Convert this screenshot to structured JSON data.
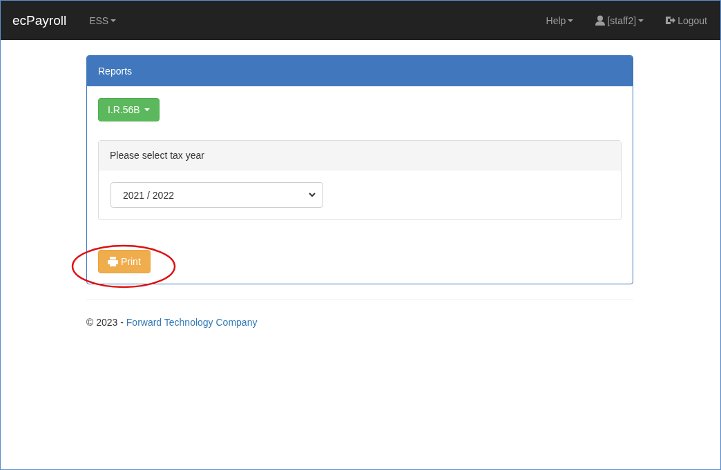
{
  "navbar": {
    "brand": "ecPayroll",
    "left_menu": [
      {
        "label": "ESS"
      }
    ],
    "right_menu": [
      {
        "label": "Help",
        "kind": "dropdown"
      },
      {
        "label": "[staff2]",
        "kind": "user"
      },
      {
        "label": "Logout",
        "kind": "logout"
      }
    ]
  },
  "panel": {
    "title": "Reports",
    "report_button": "I.R.56B",
    "sub_panel": {
      "title": "Please select tax year",
      "select_value": "2021 / 2022"
    },
    "print_button": "Print"
  },
  "footer": {
    "text": "© 2023 - ",
    "link": "Forward Technology Company"
  }
}
